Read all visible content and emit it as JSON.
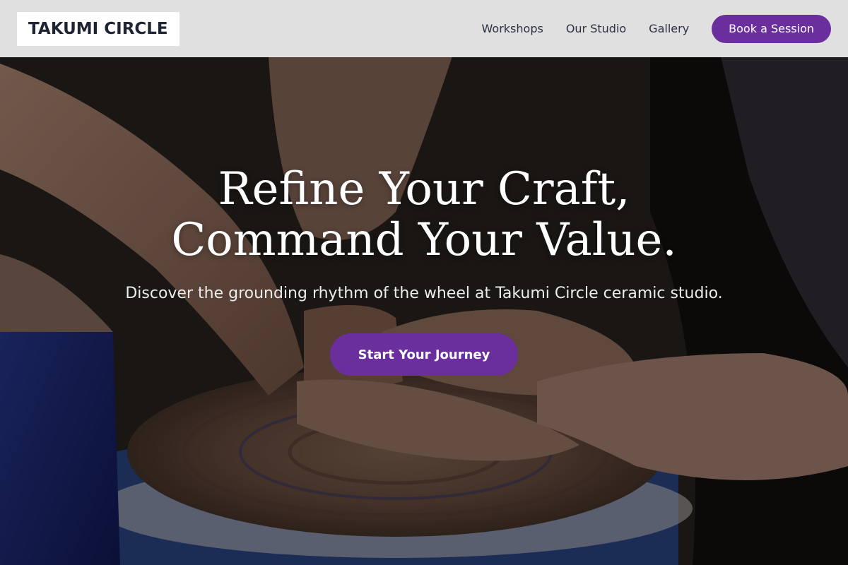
{
  "brand": {
    "name": "TAKUMI CIRCLE"
  },
  "nav": {
    "links": [
      "Workshops",
      "Our Studio",
      "Gallery"
    ],
    "cta_label": "Book a Session"
  },
  "hero": {
    "headline_line1": "Refine Your Craft,",
    "headline_line2": "Command Your Value.",
    "subheadline": "Discover the grounding rhythm of the wheel at Takumi Circle ceramic studio.",
    "cta_label": "Start Your Journey",
    "image_subject": "pottery-wheel-hands-photo"
  },
  "colors": {
    "accent": "#6a2f9c",
    "header_bg": "#f0f0f0",
    "logo_text": "#1e2433",
    "nav_text": "#2b3140"
  }
}
